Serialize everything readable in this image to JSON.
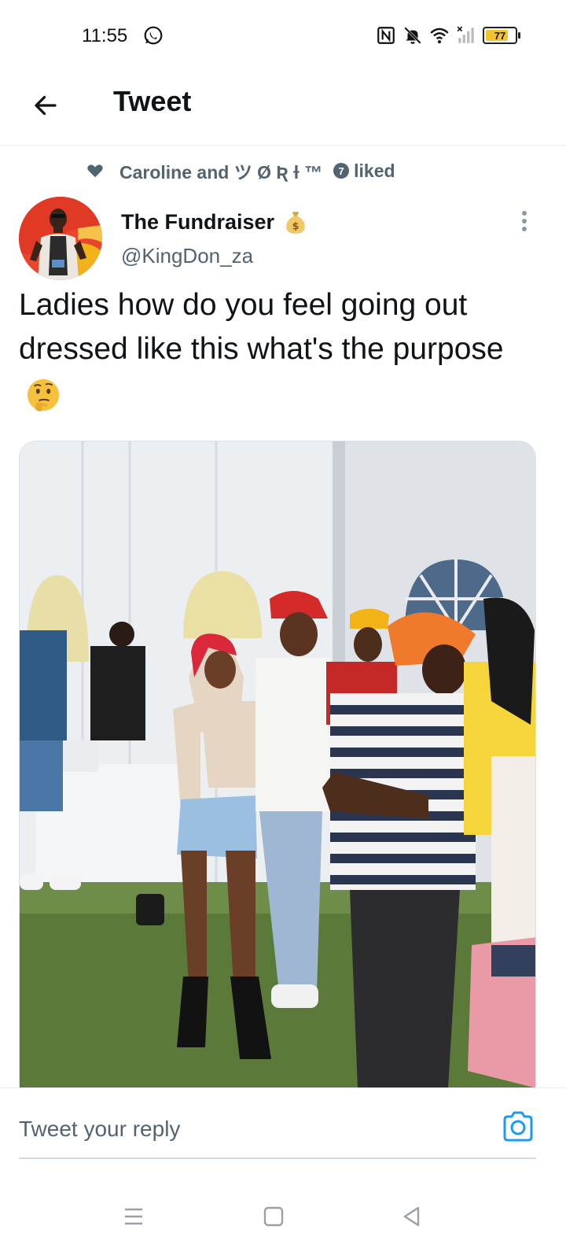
{
  "status_bar": {
    "time": "11:55",
    "battery": "77",
    "battery_level": 0.77,
    "icons": [
      "whatsapp-icon",
      "nfc-icon",
      "mute-icon",
      "wifi-icon",
      "signal-icon",
      "battery-icon"
    ]
  },
  "header": {
    "title": "Tweet"
  },
  "social_context": {
    "names": "Caroline and ツ Ø Ʀ ɫ ™",
    "badge": "7",
    "suffix": "liked"
  },
  "tweet": {
    "display_name": "The Fundraiser",
    "handle": "@KingDon_za",
    "text": "Ladies how do you feel going out dressed like this what's the purpose"
  },
  "reply": {
    "placeholder": "Tweet your reply"
  },
  "colors": {
    "accent": "#1d9bf0",
    "text_primary": "#0f1419",
    "text_secondary": "#536471",
    "divider": "#e6ecf0"
  }
}
